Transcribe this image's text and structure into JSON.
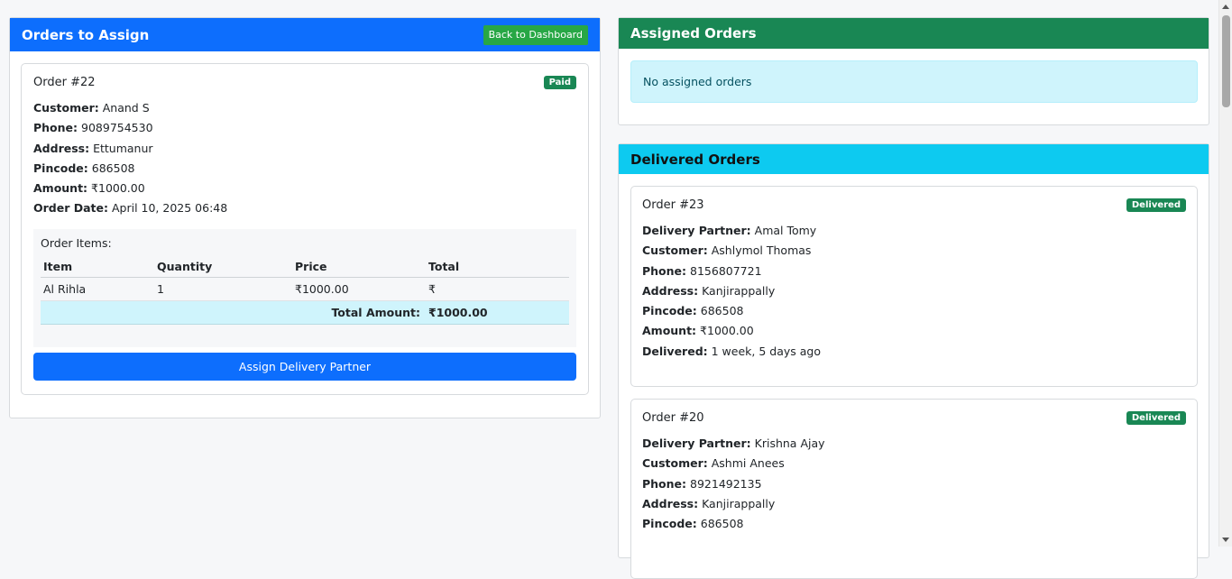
{
  "left": {
    "title": "Orders to Assign",
    "back_button": "Back to Dashboard",
    "order": {
      "title": "Order #22",
      "badge": "Paid",
      "fields": [
        {
          "k": "Customer:",
          "v": "Anand S"
        },
        {
          "k": "Phone:",
          "v": "9089754530"
        },
        {
          "k": "Address:",
          "v": "Ettumanur"
        },
        {
          "k": "Pincode:",
          "v": "686508"
        },
        {
          "k": "Amount:",
          "v": "₹1000.00"
        },
        {
          "k": "Order Date:",
          "v": "April 10, 2025 06:48"
        }
      ],
      "items_title": "Order Items:",
      "columns": [
        "Item",
        "Quantity",
        "Price",
        "Total"
      ],
      "rows": [
        {
          "item": "Al Rihla",
          "quantity": "1",
          "price": "₹1000.00",
          "total": "₹"
        }
      ],
      "total_label": "Total Amount:",
      "total_value": "₹1000.00",
      "assign_button": "Assign Delivery Partner"
    }
  },
  "assigned": {
    "title": "Assigned Orders",
    "empty_message": "No assigned orders"
  },
  "delivered": {
    "title": "Delivered Orders",
    "orders": [
      {
        "title": "Order #23",
        "badge": "Delivered",
        "fields": [
          {
            "k": "Delivery Partner:",
            "v": "Amal Tomy"
          },
          {
            "k": "Customer:",
            "v": "Ashlymol Thomas"
          },
          {
            "k": "Phone:",
            "v": "8156807721"
          },
          {
            "k": "Address:",
            "v": "Kanjirappally"
          },
          {
            "k": "Pincode:",
            "v": "686508"
          },
          {
            "k": "Amount:",
            "v": "₹1000.00"
          },
          {
            "k": "Delivered:",
            "v": "1 week, 5 days ago"
          }
        ]
      },
      {
        "title": "Order #20",
        "badge": "Delivered",
        "fields": [
          {
            "k": "Delivery Partner:",
            "v": "Krishna Ajay"
          },
          {
            "k": "Customer:",
            "v": "Ashmi Anees"
          },
          {
            "k": "Phone:",
            "v": "8921492135"
          },
          {
            "k": "Address:",
            "v": "Kanjirappally"
          },
          {
            "k": "Pincode:",
            "v": "686508"
          }
        ]
      }
    ]
  },
  "colors": {
    "primary": "#0d6efd",
    "success": "#198754",
    "info": "#0dcaf0",
    "back_button": "#28a745"
  }
}
